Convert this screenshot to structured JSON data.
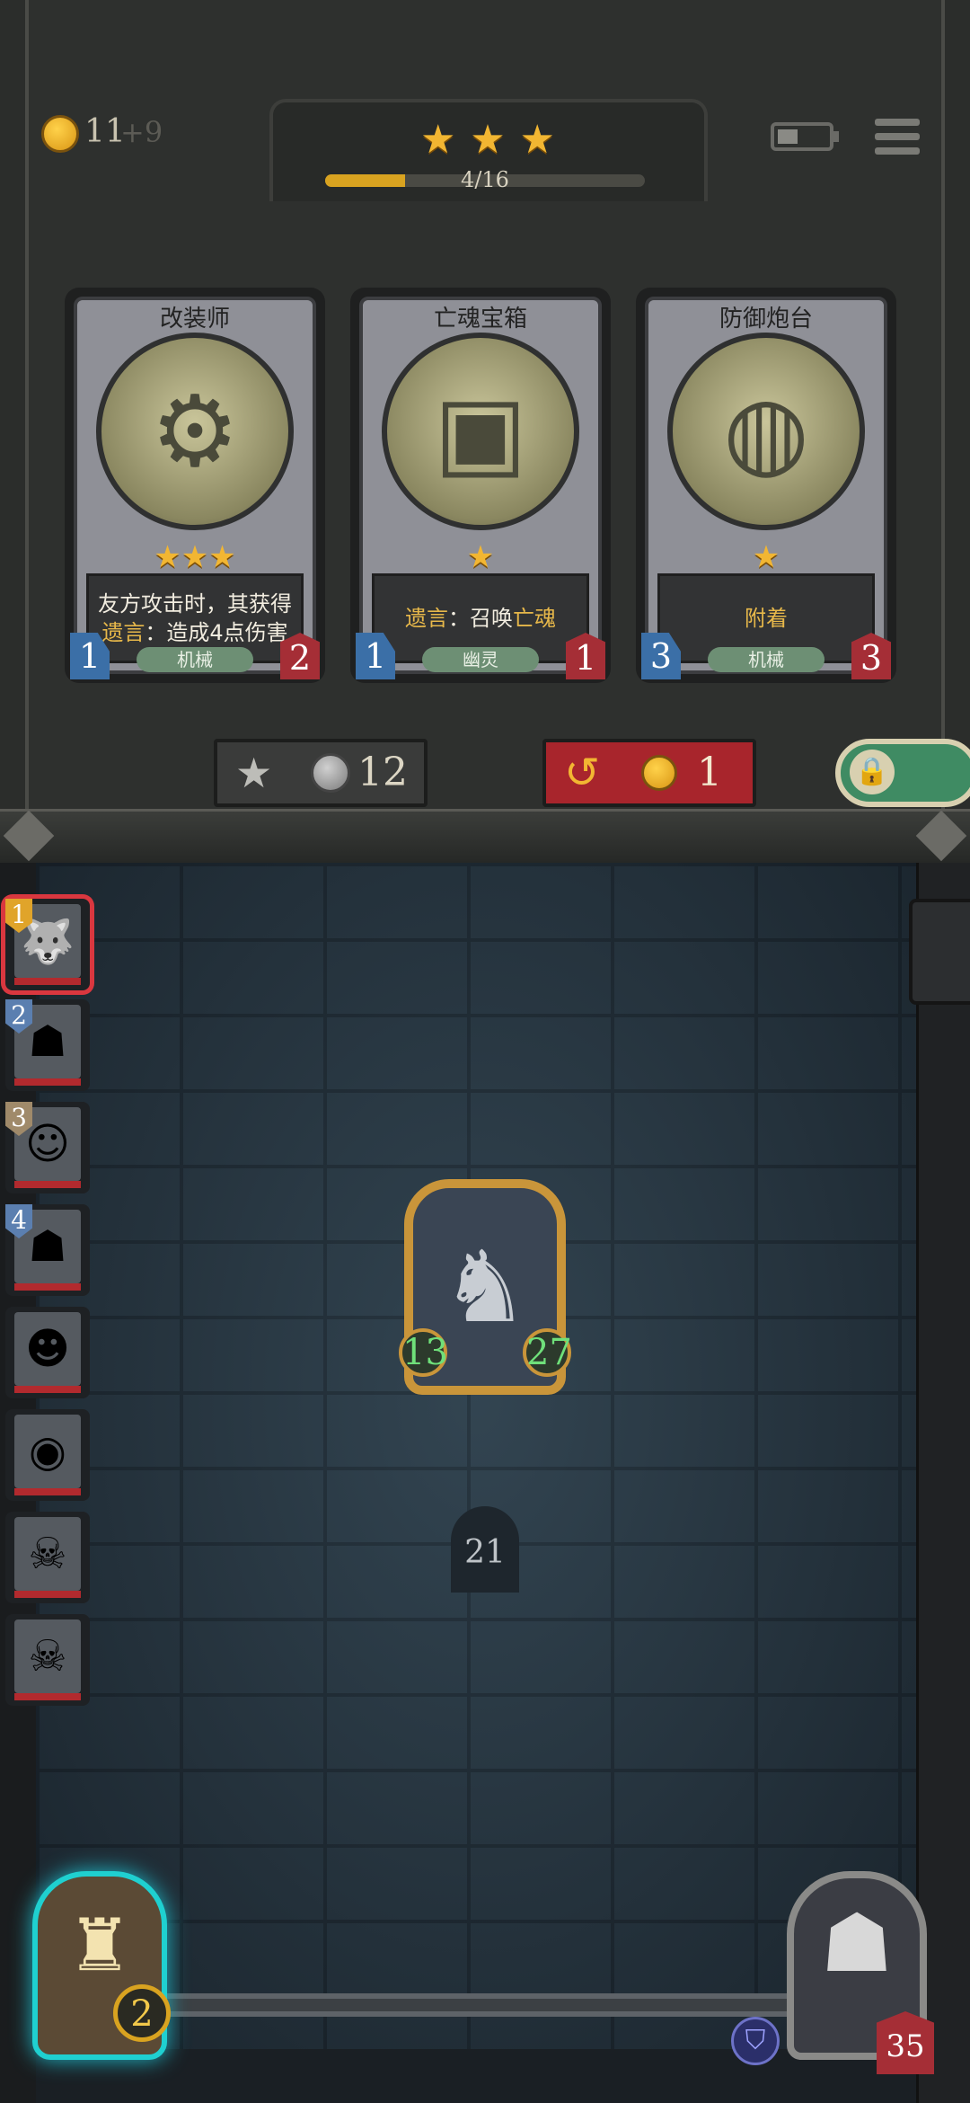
{
  "header": {
    "gold": "11",
    "gold_income": "+9",
    "tier_stars": [
      "★",
      "★",
      "★"
    ],
    "level_progress_text": "4/16",
    "level_progress_fraction": 0.25
  },
  "shop_cards": [
    {
      "name": "改装师",
      "stars": "★★★",
      "desc_line1": "友方攻击时，其获得",
      "desc_kw": "遗言",
      "desc_line2": "：造成4点伤害",
      "tag": "机械",
      "attack": "1",
      "health": "2",
      "art_icon": "robot-icon"
    },
    {
      "name": "亡魂宝箱",
      "stars": "★",
      "desc_kw": "遗言",
      "desc_mid": "：召唤",
      "desc_kw2": "亡魂",
      "tag": "幽灵",
      "attack": "1",
      "health": "1",
      "art_icon": "mimic-chest-icon"
    },
    {
      "name": "防御炮台",
      "stars": "★",
      "desc_kw": "附着",
      "tag": "机械",
      "attack": "3",
      "health": "3",
      "art_icon": "turret-icon"
    }
  ],
  "buttons": {
    "upgrade_cost": "12",
    "refresh_cost": "1"
  },
  "roster": [
    {
      "num": "1",
      "icon": "wolf-icon",
      "num_color": "#e0a42a",
      "active": true
    },
    {
      "num": "2",
      "icon": "wizard-icon",
      "num_color": "#5b7fb0",
      "active": false
    },
    {
      "num": "3",
      "icon": "old-man-icon",
      "num_color": "#a08a6a",
      "active": false
    },
    {
      "num": "4",
      "icon": "hooded-icon",
      "num_color": "#5b7fb0",
      "active": false
    },
    {
      "num": "",
      "icon": "dwarf-icon",
      "num_color": "",
      "active": false
    },
    {
      "num": "",
      "icon": "owl-icon",
      "num_color": "",
      "active": false
    },
    {
      "num": "",
      "icon": "vampire-icon",
      "num_color": "",
      "active": false
    },
    {
      "num": "",
      "icon": "skull-icon",
      "num_color": "",
      "active": false
    }
  ],
  "unit": {
    "attack": "13",
    "health": "27",
    "icon": "knight-icon"
  },
  "round": "21",
  "lantern_count": "2",
  "hero_health": "35",
  "colors": {
    "gold": "#f2b632",
    "refresh_red": "#a8252c",
    "lock_green": "#3f8b63",
    "stat_green": "#6fe07a",
    "hp_red": "#a52e36",
    "atk_blue": "#3b6fa7"
  }
}
